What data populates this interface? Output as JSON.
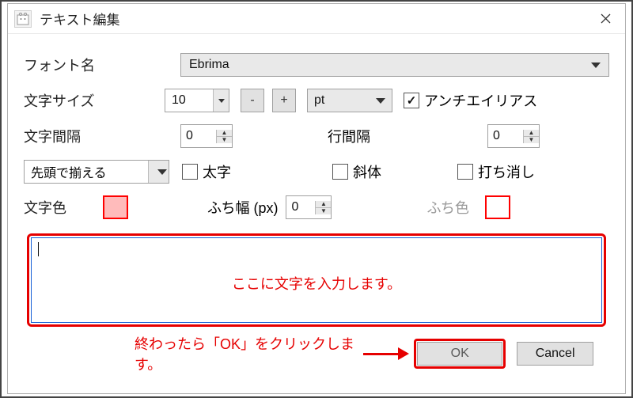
{
  "window": {
    "title": "テキスト編集"
  },
  "labels": {
    "font_name": "フォント名",
    "char_size": "文字サイズ",
    "char_spacing": "文字間隔",
    "line_spacing": "行間隔",
    "bold": "太字",
    "italic": "斜体",
    "strike": "打ち消し",
    "color": "文字色",
    "outline_width": "ふち幅 (px)",
    "outline_color": "ふち色",
    "antialias": "アンチエイリアス",
    "align": "先頭で揃える",
    "unit": "pt"
  },
  "values": {
    "font": "Ebrima",
    "size": "10",
    "char_spacing": "0",
    "line_spacing": "0",
    "outline_width": "0",
    "antialias_checked": true,
    "bold_checked": false,
    "italic_checked": false,
    "strike_checked": false
  },
  "annotations": {
    "textarea_hint": "ここに文字を入力します。",
    "ok_hint": "終わったら「OK」をクリックします。"
  },
  "buttons": {
    "ok": "OK",
    "cancel": "Cancel",
    "minus": "-",
    "plus": "+"
  }
}
